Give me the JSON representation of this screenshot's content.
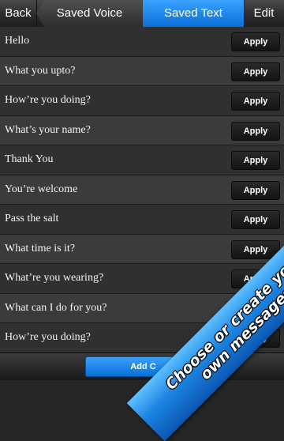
{
  "nav": {
    "back": "Back",
    "tabs": [
      {
        "label": "Saved Voice",
        "active": false
      },
      {
        "label": "Saved Text",
        "active": true
      }
    ],
    "edit": "Edit"
  },
  "apply_label": "Apply",
  "items": [
    "Hello",
    "What you upto?",
    "How’re you doing?",
    "What’s your name?",
    "Thank You",
    "You’re welcome",
    "Pass the salt",
    "What time is it?",
    "What’re you wearing?",
    "What can I do for you?",
    "How’re you doing?"
  ],
  "bottom": {
    "add_button": "Add C"
  },
  "banner": {
    "line1": "Choose or create your",
    "line2": "own messages"
  },
  "colors": {
    "accent": "#1a86e6",
    "banner": "#1b83e0"
  }
}
